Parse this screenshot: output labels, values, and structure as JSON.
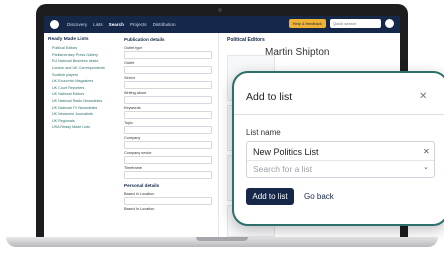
{
  "topbar": {
    "nav": [
      "Discovery",
      "Lists",
      "Search",
      "Projects",
      "Distribution"
    ],
    "active_nav": "Search",
    "help_label": "Help & feedback",
    "search_placeholder": "Quick search"
  },
  "sidebar": {
    "title": "Ready Made Lists",
    "items": [
      "Political Editors",
      "Parliamentary Press Gallery",
      "EU National Business desks",
      "London and UK Correspondents",
      "Scottish players",
      "UK Economic Magazines",
      "UK Court Reporters",
      "UK National Editors",
      "UK National Radio Newsdesks",
      "UK National TV Newsdesks",
      "UK Newswire Journalists",
      "UK Regionals",
      "USA Ready Made Lists"
    ]
  },
  "filters": {
    "title": "Publication details",
    "fields": [
      "Outlet type",
      "Outlet",
      "Sector",
      "Writing about",
      "Keywords",
      "Topic",
      "Company",
      "Company sector",
      "Timeframe",
      "Personal details",
      "Based In Location",
      "Based In Location"
    ]
  },
  "main": {
    "title": "Political Editors",
    "background_name": "Martin Shipton"
  },
  "modal": {
    "title": "Add to list",
    "close_icon": "close-icon",
    "list_name_label": "List name",
    "selected_value": "New Politics List",
    "search_placeholder": "Search for a list",
    "add_button": "Add to list",
    "back_link": "Go back"
  },
  "colors": {
    "brand": "#15284a",
    "accent": "#2d6f6b"
  }
}
